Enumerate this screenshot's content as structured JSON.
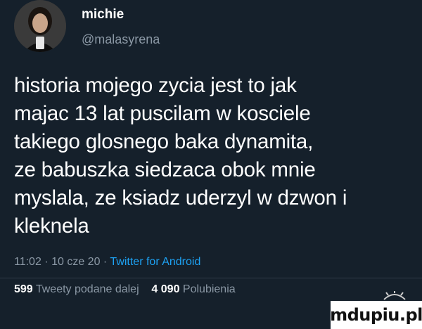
{
  "author": {
    "display_name": "michie",
    "handle": "@malasyrena"
  },
  "tweet": {
    "lines": [
      "historia mojego zycia jest to jak",
      "majac 13 lat puscilam w kosciele",
      "takiego glosnego baka dynamita,",
      "ze babuszka siedzaca obok mnie",
      "myslala, ze ksiadz uderzyl w dzwon i",
      "kleknela"
    ]
  },
  "meta": {
    "time": "11:02",
    "separator1": " · ",
    "date": "10 cze 20",
    "separator2": " · ",
    "source": "Twitter for Android"
  },
  "stats": {
    "retweets_count": "599",
    "retweets_label": "Tweety podane dalej",
    "likes_count": "4 090",
    "likes_label": "Polubienia"
  },
  "watermark": {
    "text": "mdupiu.pl"
  },
  "colors": {
    "background": "#15202b",
    "secondary_text": "#8b98a5",
    "link": "#1da1f2"
  }
}
